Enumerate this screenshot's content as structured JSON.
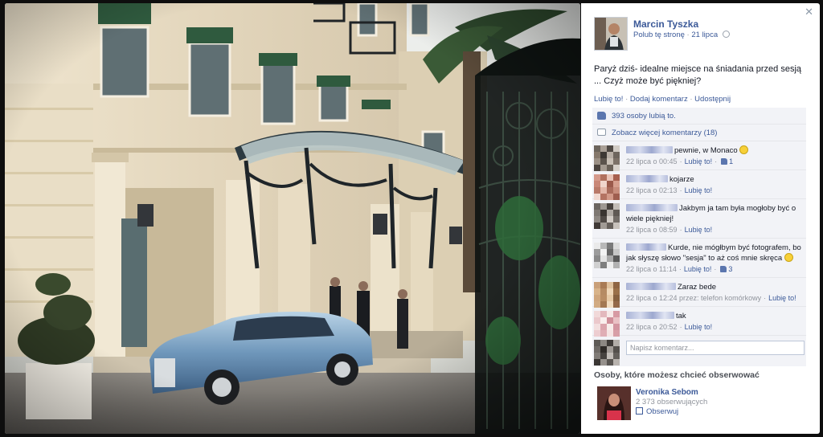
{
  "window": {
    "close_glyph": "✕"
  },
  "post": {
    "author": "Marcin Tyszka",
    "like_page": "Polub tę stronę",
    "date": "21 lipca",
    "text": "Paryż dziś- idealne miejsce na śniadania przed sesją ... Czyż może być piękniej?",
    "actions": {
      "like": "Lubię to!",
      "comment": "Dodaj komentarz",
      "share": "Udostępnij",
      "sep": "·"
    }
  },
  "ufi": {
    "likes": "393 osoby lubią to.",
    "more_comments": "Zobacz więcej komentarzy (18)",
    "comments": [
      {
        "text": "pewnie, w Monaco",
        "emoji": "smile",
        "time": "22 lipca o 00:45",
        "like": "Lubię to!",
        "likes": "1",
        "avatar": [
          "#6d655c",
          "#a99f95",
          "#4f4944",
          "#d1cbc4",
          "#85786b",
          "#3d3834",
          "#b7aea5",
          "#6e665e",
          "#9b9085",
          "#5b534c",
          "#c9c0b6",
          "#7d7268",
          "#4a433d",
          "#a49a90",
          "#6a6158",
          "#d7d1ca"
        ]
      },
      {
        "text": "kojarze",
        "time": "22 lipca o 02:13",
        "like": "Lubię to!",
        "avatar": [
          "#d59a8a",
          "#b0705e",
          "#e9c3b6",
          "#a7604f",
          "#c98878",
          "#f0d5cc",
          "#9b5a4b",
          "#d7a08f",
          "#b97a69",
          "#e3b7a9",
          "#a96b5b",
          "#c78d7c",
          "#f1d9d0",
          "#b47362",
          "#d39a89",
          "#9f5e4f"
        ]
      },
      {
        "text": "Jakbym ja tam była mogłoby być o wiele piękniej!",
        "time": "22 lipca o 08:59",
        "like": "Lubię to!",
        "avatar": [
          "#6c6661",
          "#9e9892",
          "#48423e",
          "#c3bdb7",
          "#7e7872",
          "#393430",
          "#b0aaa4",
          "#5f5954",
          "#8e8882",
          "#4f4945",
          "#d3cdc7",
          "#726c67",
          "#403a36",
          "#a19b95",
          "#66605b",
          "#c8c2bc"
        ]
      },
      {
        "text": "Kurde, nie mógłbym być fotografem, bo jak słyszę słowo \"sesja\" to aż coś mnie skręca",
        "emoji": "grin",
        "time": "22 lipca o 11:14",
        "like": "Lubię to!",
        "likes": "3",
        "avatar": [
          "#eaeaea",
          "#b8b8b8",
          "#7a7a7a",
          "#dcdcdc",
          "#9c9c9c",
          "#f3f3f3",
          "#676767",
          "#c6c6c6",
          "#8a8a8a",
          "#e4e4e4",
          "#a9a9a9",
          "#595959",
          "#d0d0d0",
          "#7f7f7f",
          "#efefef",
          "#b2b2b2"
        ]
      },
      {
        "text": "Zaraz bede",
        "time": "22 lipca o 12:24 przez: telefon komórkowy",
        "like": "Lubię to!",
        "avatar": [
          "#c9a079",
          "#a97b55",
          "#e0c29e",
          "#8f6543",
          "#d8b389",
          "#b58b63",
          "#efd7b8",
          "#9a7049",
          "#cfa67d",
          "#b88d64",
          "#e7cba7",
          "#86603f",
          "#d2ab82",
          "#a37852",
          "#f1dcc0",
          "#94694a"
        ]
      },
      {
        "text": "tak",
        "time": "22 lipca o 20:52",
        "like": "Lubię to!",
        "avatar": [
          "#f1d9d9",
          "#e3b8bd",
          "#f7e9e8",
          "#d79aa3",
          "#ebc9cc",
          "#f9eeed",
          "#cf8e99",
          "#e9c1c5",
          "#f3dfdf",
          "#dba4ac",
          "#f8ecea",
          "#d295a0",
          "#edcdd0",
          "#e0aeb5",
          "#f6e5e4",
          "#d89fa7"
        ]
      }
    ],
    "write_placeholder": "Napisz komentarz...",
    "my_avatar": [
      "#5e5a56",
      "#8d8883",
      "#3f3b38",
      "#b2ada8",
      "#6f6a66",
      "#2f2b28",
      "#a19c97",
      "#54504c",
      "#807b76",
      "#46423f",
      "#c2bdb8",
      "#64605c",
      "#3a3633",
      "#96918c",
      "#5a5652",
      "#b8b3ae"
    ]
  },
  "suggestions": {
    "title": "Osoby, które możesz chcieć obserwować",
    "name": "Veronika Sebom",
    "followers": "2 373 obserwujących",
    "follow": "Obserwuj"
  },
  "colors": {
    "link": "#3b5998",
    "meta": "#90949c",
    "ufi_bg": "#f2f3f7"
  }
}
